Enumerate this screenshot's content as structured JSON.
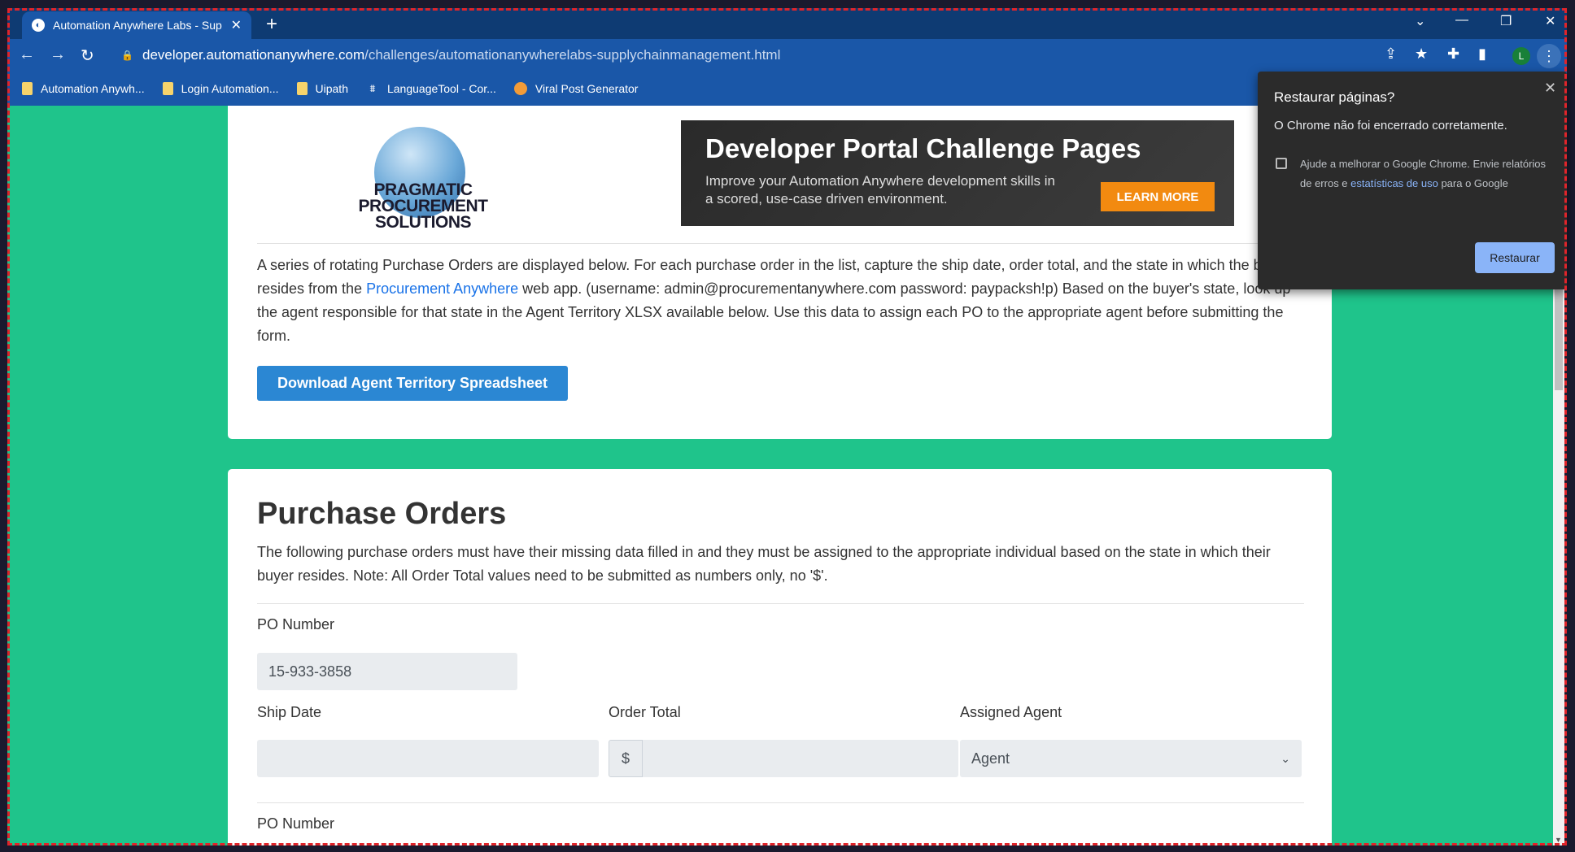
{
  "browser": {
    "tab_title": "Automation Anywhere Labs - Sup",
    "new_tab": "+",
    "url_host": "developer.automationanywhere.com",
    "url_path": "/challenges/automationanywherelabs-supplychainmanagement.html",
    "profile_initial": "L",
    "bookmarks": [
      {
        "label": "Automation Anywh...",
        "icon": "folder-icon"
      },
      {
        "label": "Login Automation...",
        "icon": "folder-icon"
      },
      {
        "label": "Uipath",
        "icon": "folder-icon"
      },
      {
        "label": "LanguageTool - Cor...",
        "icon": "languagetool-icon"
      },
      {
        "label": "Viral Post Generator",
        "icon": "viral-icon"
      }
    ]
  },
  "header": {
    "logo_text": "PRAGMATIC PROCUREMENT SOLUTIONS",
    "banner_title": "Developer Portal Challenge Pages",
    "banner_text": "Improve your Automation Anywhere development skills in a scored, use-case driven environment.",
    "banner_button": "LEARN MORE"
  },
  "intro": {
    "text_before_link": "A series of rotating Purchase Orders are displayed below. For each purchase order in the list, capture the ship date, order total, and the state in which the buyer resides from the ",
    "link": "Procurement Anywhere",
    "text_after_link": " web app. (username: admin@procurementanywhere.com password: paypacksh!p) Based on the buyer's state, look up the agent responsible for that state in the Agent Territory XLSX available below. Use this data to assign each PO to the appropriate agent before submitting the form.",
    "download_button": "Download Agent Territory Spreadsheet"
  },
  "purchase_orders": {
    "title": "Purchase Orders",
    "description": "The following purchase orders must have their missing data filled in and they must be assigned to the appropriate individual based on the state in which their buyer resides. Note: All Order Total values need to be submitted as numbers only, no '$'.",
    "po_number_label": "PO Number",
    "po_number_value": "15-933-3858",
    "ship_date_label": "Ship Date",
    "order_total_label": "Order Total",
    "currency_addon": "$",
    "assigned_agent_label": "Assigned Agent",
    "agent_select_value": "Agent",
    "next_po_number_label": "PO Number"
  },
  "popup": {
    "title": "Restaurar páginas?",
    "description": "O Chrome não foi encerrado corretamente.",
    "checkbox_text_before": "Ajude a melhorar o Google Chrome. Envie relatórios de erros e ",
    "checkbox_link": "estatísticas de uso",
    "checkbox_text_after": " para o Google",
    "restore_button": "Restaurar"
  }
}
